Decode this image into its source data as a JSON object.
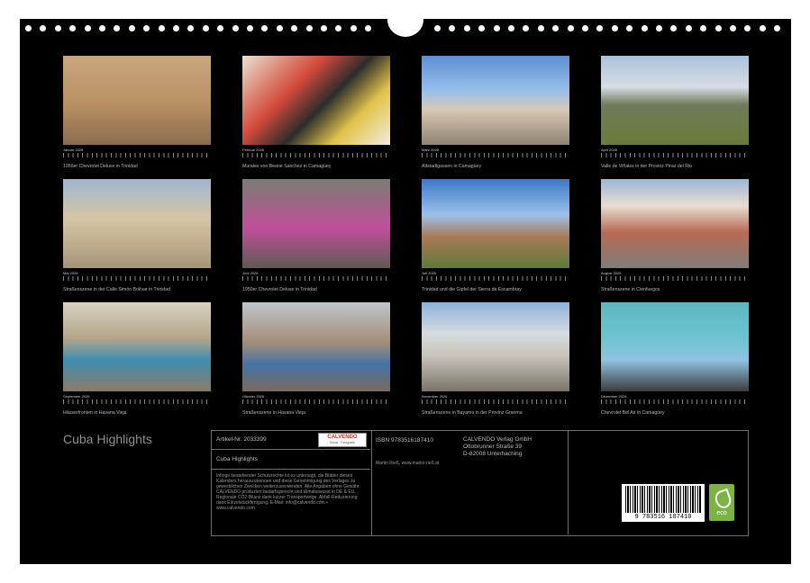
{
  "calendar_title": "Cuba Highlights",
  "months": [
    {
      "month": "Januar 2026",
      "caption": "1950er Chevrolet Deluxe in Trinidad"
    },
    {
      "month": "Februar 2026",
      "caption": "Murales von Beane Sanchez in Camagüey"
    },
    {
      "month": "März 2026",
      "caption": "Altstadtgassen in Camagüey"
    },
    {
      "month": "April 2026",
      "caption": "Valle de Viñales in der Provinz Pinar del Rio"
    },
    {
      "month": "Mai 2026",
      "caption": "Straßenszene in der Calle Simón Bolívar in Trinidad"
    },
    {
      "month": "Juni 2026",
      "caption": "1950er Chevrolet Deluxe in Trinidad"
    },
    {
      "month": "Juli 2026",
      "caption": "Trinidad und die Gipfel der Sierra de Escambray"
    },
    {
      "month": "August 2026",
      "caption": "Straßenszene in Cienfuegos"
    },
    {
      "month": "September 2026",
      "caption": "Häuserfronten in Havana Vieja"
    },
    {
      "month": "Oktober 2026",
      "caption": "Straßenszene in Havana Vieja"
    },
    {
      "month": "November 2026",
      "caption": "Straßenszene in Bayamo in der Provinz Granma"
    },
    {
      "month": "Dezember 2026",
      "caption": "Chevrolet Bel Air in Camagüey"
    }
  ],
  "info": {
    "article_no": "Artikel-Nr. 2033399",
    "product_title": "Cuba Highlights",
    "isbn": "ISBN 9783516187410",
    "author": "Martin Rieß, www.marko-rieß.at",
    "publisher_line1": "CALVENDO Verlag GmbH",
    "publisher_line2": "Ottobrunner Straße 39",
    "publisher_line3": "D-82008 Unterhaching",
    "logo_text": "CALVENDO",
    "logo_sub": "Kunst · Fotografie",
    "legal_text": "Infolge bestehender Schutzrechte ist es untersagt, die Blätter dieses Kalenders herauszutrennen und diese Genehmigung des Verlages zu gewerblichen Zwecken weiterzuverwenden. Alle Angaben ohne Gewähr. CALVENDO produziert bedarfsgerecht und klimabewusst in DE & EU. Regionale CO2-Bilanz dank kurzer Transportwege. Abfall-Reduzierung dank Einzelstückfertigung. E-Mail: info@calvendo.com • www.calvendo.com",
    "barcode_digits": "9 783516 187410",
    "eco_label": "eco"
  },
  "colors": {
    "background": "#000000",
    "paper": "#ffffff",
    "eco_green": "#7cb342"
  }
}
